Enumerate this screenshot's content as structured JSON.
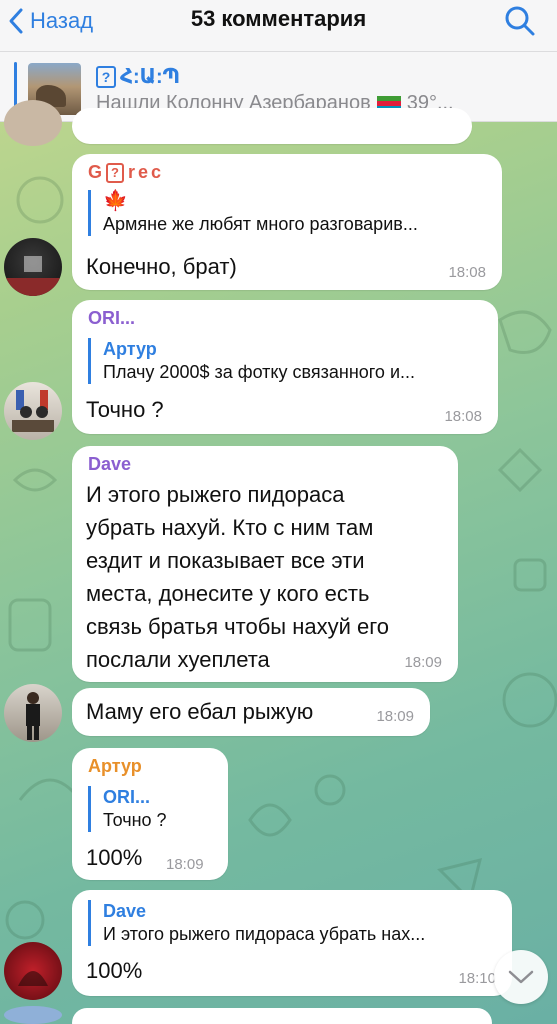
{
  "header": {
    "back_label": "Назад",
    "title": "53 комментария"
  },
  "pinned": {
    "title": "Հ:Ա:Պ",
    "text": "Нашли Колонну Азербаранов",
    "suffix": "39°..."
  },
  "messages": [
    {
      "sender": "G?rec",
      "sender_color": "#e05b4b",
      "reply_name": "🍁",
      "reply_text": "Армяне же любят много разговарив...",
      "text": "Конечно, брат)",
      "time": "18:08"
    },
    {
      "sender": "ORI...",
      "sender_color": "#8b5fd0",
      "reply_name": "Артур",
      "reply_text": "Плачу 2000$ за фотку связанного и...",
      "text": "Точно ?",
      "time": "18:08"
    },
    {
      "sender": "Dave",
      "sender_color": "#8b5fd0",
      "text_lines": [
        "И этого рыжего пидораса",
        "убрать нахуй. Кто с ним там",
        "ездит и показывает все эти",
        "места, донесите у кого есть",
        "связь братья чтобы нахуй его",
        "послали хуеплета"
      ],
      "time": "18:09"
    },
    {
      "text": "Маму его ебал рыжую",
      "time": "18:09"
    },
    {
      "sender": "Артур",
      "sender_color": "#e8902a",
      "reply_name": "ORI...",
      "reply_text": "Точно ?",
      "text": "100%",
      "time": "18:09"
    },
    {
      "reply_name": "Dave",
      "reply_text": "И этого рыжего пидораса убрать нах...",
      "text": "100%",
      "time": "18:10"
    }
  ],
  "icons": {
    "back": "chevron-left-icon",
    "search": "search-icon",
    "scroll_down": "chevron-down-icon"
  },
  "colors": {
    "accent": "#2f7fe0"
  }
}
